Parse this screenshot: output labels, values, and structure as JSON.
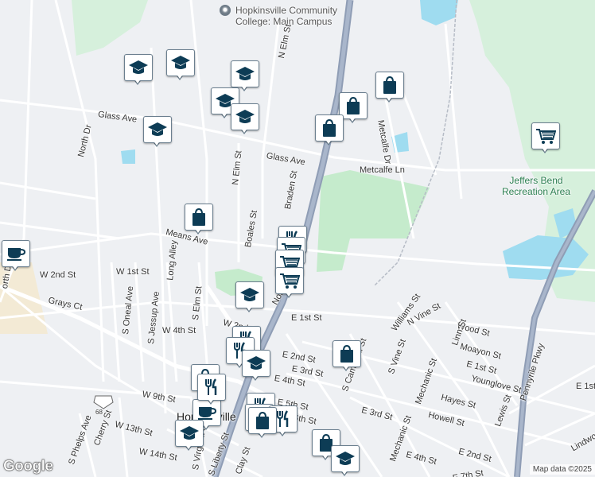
{
  "map": {
    "poi_college": "Hopkinsville Community College: Main Campus",
    "park": "Jeffers Bend Recreation Area",
    "attribution": "Map data ©2025",
    "google_logo": "Google",
    "shield_68": "68"
  },
  "streets": [
    "N Elm St",
    "Glass Ave",
    "Glass Ave",
    "North Dr",
    "N Elm St",
    "Braden St",
    "Metcalfe Dr",
    "Metcalfe Ln",
    "Boales St",
    "Means Ave",
    "W 1st St",
    "W 2nd St",
    "Grays Ct",
    "S Oneal Ave",
    "S Jessup Ave",
    "Long Alley",
    "S Elm St",
    "W 2nd St",
    "W 4th St",
    "E 1st St",
    "E 2nd St",
    "E 3rd St",
    "E 4th St",
    "E 5th St",
    "E 6th St",
    "S Campbell St",
    "S Vine St",
    "Williams St",
    "N Vine St",
    "Wood St",
    "Linn St",
    "Moayon St",
    "E 1st St",
    "Mechanic St",
    "Younglove St",
    "Hayes St",
    "Howell St",
    "Lewis St",
    "E 3rd St",
    "E 2nd St",
    "E 4th St",
    "Mechanic St",
    "W 9th St",
    "W 13th St",
    "Cherry St",
    "W 14th St",
    "S Phelps Ave",
    "S Virginia St",
    "S Liberty St",
    "Clay St",
    "Pennyrile Pkwy",
    "Lindwood",
    "E 1st",
    "E 7th St",
    "Hopkinsville",
    "Nor",
    "N",
    "orth Dr"
  ],
  "markers": [
    {
      "type": "school",
      "name": "school-marker"
    },
    {
      "type": "school",
      "name": "school-marker"
    },
    {
      "type": "school",
      "name": "school-marker"
    },
    {
      "type": "school",
      "name": "school-marker"
    },
    {
      "type": "school",
      "name": "school-marker"
    },
    {
      "type": "school",
      "name": "school-marker"
    },
    {
      "type": "shopping-bag",
      "name": "store-marker"
    },
    {
      "type": "shopping-bag",
      "name": "store-marker"
    },
    {
      "type": "shopping-bag",
      "name": "store-marker"
    },
    {
      "type": "shopping-bag",
      "name": "store-marker"
    },
    {
      "type": "cart",
      "name": "grocery-marker"
    },
    {
      "type": "cafe",
      "name": "cafe-marker"
    },
    {
      "type": "restaurant",
      "name": "restaurant-marker"
    },
    {
      "type": "cart",
      "name": "grocery-marker"
    },
    {
      "type": "cart",
      "name": "grocery-marker"
    },
    {
      "type": "cart",
      "name": "grocery-marker"
    },
    {
      "type": "school",
      "name": "school-marker"
    },
    {
      "type": "restaurant",
      "name": "restaurant-marker"
    },
    {
      "type": "restaurant",
      "name": "restaurant-marker"
    },
    {
      "type": "school",
      "name": "school-marker"
    },
    {
      "type": "shopping-bag",
      "name": "store-marker"
    },
    {
      "type": "shopping-bag",
      "name": "store-marker"
    },
    {
      "type": "restaurant",
      "name": "restaurant-marker"
    },
    {
      "type": "cart",
      "name": "grocery-marker"
    },
    {
      "type": "restaurant",
      "name": "restaurant-marker"
    },
    {
      "type": "cafe",
      "name": "cafe-marker"
    },
    {
      "type": "school",
      "name": "school-marker"
    },
    {
      "type": "shopping-bag",
      "name": "store-marker"
    },
    {
      "type": "school",
      "name": "school-marker"
    },
    {
      "type": "shopping-bag",
      "name": "store-marker"
    },
    {
      "type": "restaurant",
      "name": "restaurant-marker"
    }
  ],
  "colors": {
    "water": "#9fdcf0",
    "park": "#c7ecd0",
    "highway": "#8f9db5",
    "marker_icon": "#0d3c55"
  }
}
